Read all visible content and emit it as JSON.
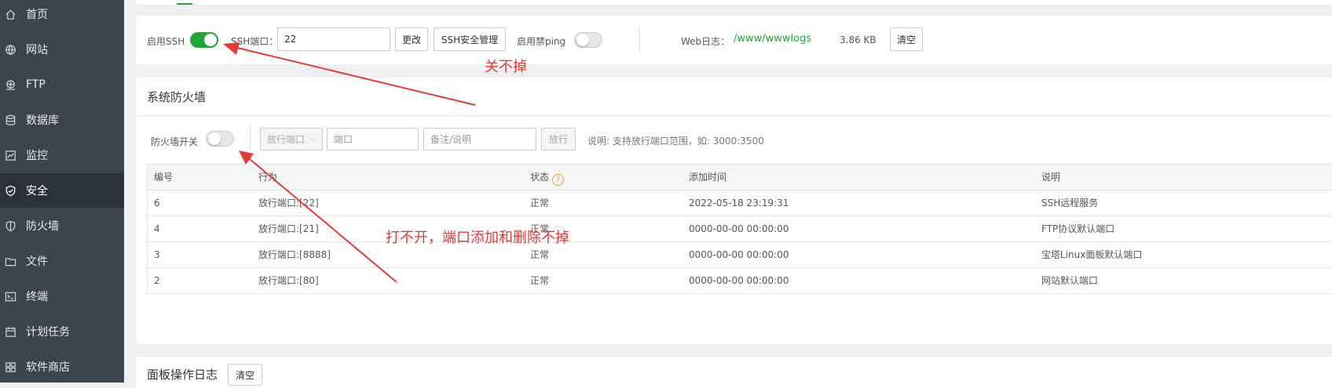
{
  "sidebar": {
    "items": [
      {
        "label": "首页",
        "icon": "home-icon",
        "active": false
      },
      {
        "label": "网站",
        "icon": "globe-icon",
        "active": false
      },
      {
        "label": "FTP",
        "icon": "ftp-icon",
        "active": false
      },
      {
        "label": "数据库",
        "icon": "database-icon",
        "active": false
      },
      {
        "label": "监控",
        "icon": "monitor-icon",
        "active": false
      },
      {
        "label": "安全",
        "icon": "shield-check-icon",
        "active": true
      },
      {
        "label": "防火墙",
        "icon": "firewall-shield-icon",
        "active": false
      },
      {
        "label": "文件",
        "icon": "folder-icon",
        "active": false
      },
      {
        "label": "终端",
        "icon": "terminal-icon",
        "active": false
      },
      {
        "label": "计划任务",
        "icon": "calendar-icon",
        "active": false
      },
      {
        "label": "软件商店",
        "icon": "apps-grid-icon",
        "active": false
      }
    ]
  },
  "ssh": {
    "enable_label": "启用SSH",
    "enabled": true,
    "port_label": "SSH端口：",
    "port_value": "22",
    "change_button": "更改",
    "manage_button": "SSH安全管理",
    "ping_label": "启用禁ping",
    "ping_enabled": false,
    "weblog_label": "Web日志：",
    "weblog_path": "/www/wwwlogs",
    "weblog_size": "3.86 KB",
    "clear_button": "清空"
  },
  "firewall": {
    "title": "系统防火墙",
    "switch_label": "防火墙开关",
    "enabled": false,
    "select_value": "放行端口",
    "port_placeholder": "端口",
    "note_placeholder": "备注/说明",
    "allow_button": "放行",
    "hint": "说明: 支持放行端口范围，如: 3000:3500",
    "columns": [
      "编号",
      "行为",
      "状态",
      "添加时间",
      "说明"
    ],
    "rows": [
      {
        "id": "6",
        "action": "放行端口:[22]",
        "status": "正常",
        "time": "2022-05-18 23:19:31",
        "desc": "SSH远程服务"
      },
      {
        "id": "4",
        "action": "放行端口:[21]",
        "status": "正常",
        "time": "0000-00-00 00:00:00",
        "desc": "FTP协议默认端口"
      },
      {
        "id": "3",
        "action": "放行端口:[8888]",
        "status": "正常",
        "time": "0000-00-00 00:00:00",
        "desc": "宝塔Linux面板默认端口"
      },
      {
        "id": "2",
        "action": "放行端口:[80]",
        "status": "正常",
        "time": "0000-00-00 00:00:00",
        "desc": "网站默认端口"
      }
    ]
  },
  "panel_log": {
    "title": "面板操作日志",
    "clear_button": "清空"
  },
  "annotations": {
    "ssh_note": "关不掉",
    "firewall_note": "打不开，端口添加和删除不掉",
    "color": "#e53935"
  },
  "colors": {
    "accent": "#20a53a",
    "sidebar_bg": "#3c444d",
    "sidebar_active": "#2b3239"
  }
}
